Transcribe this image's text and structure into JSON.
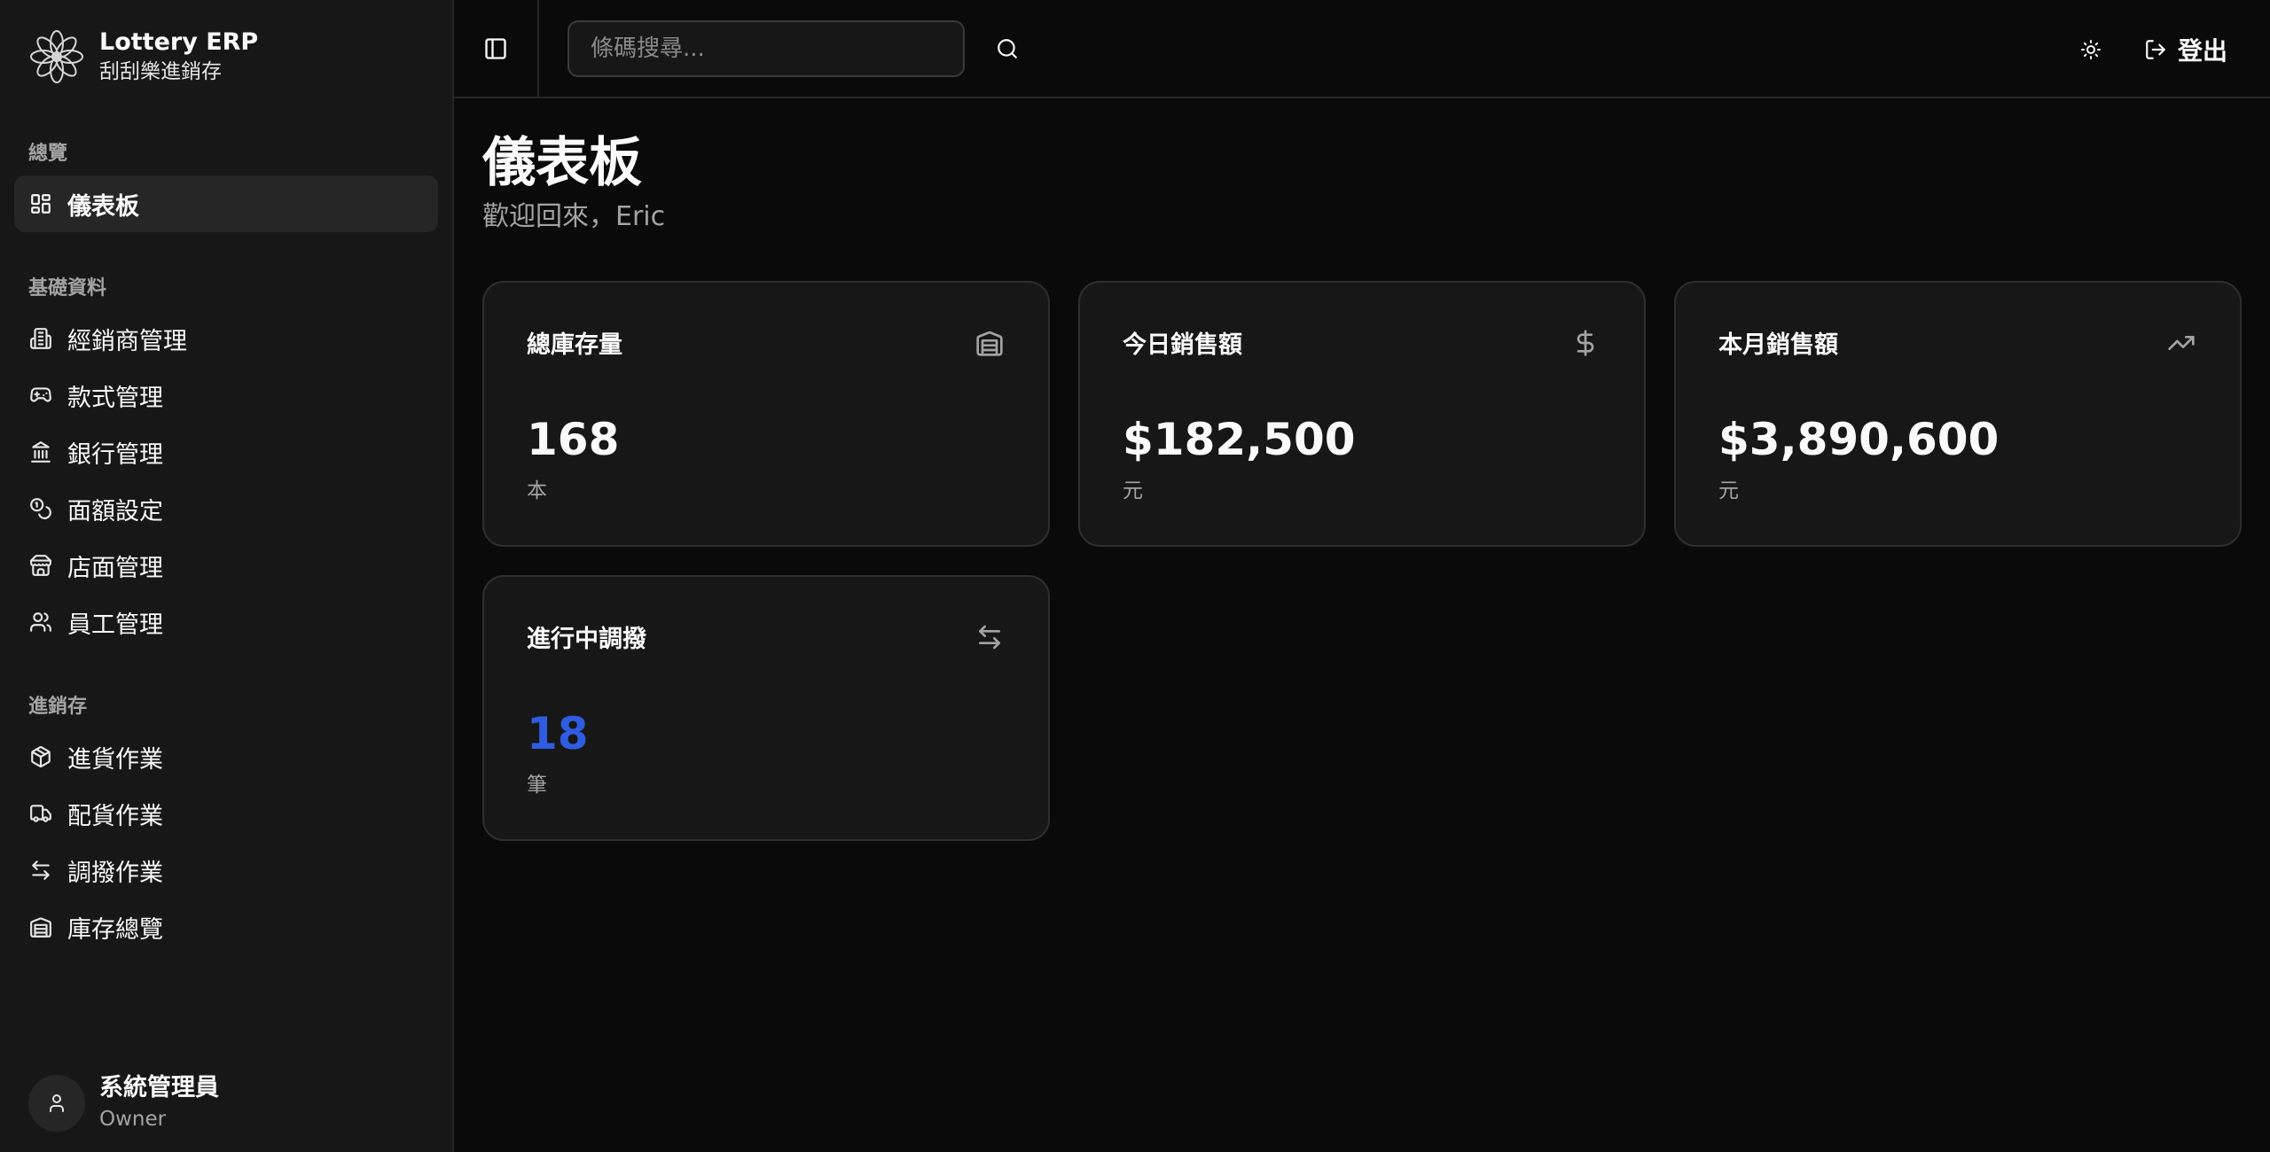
{
  "brand": {
    "name": "Lottery ERP",
    "subtitle": "刮刮樂進銷存",
    "logo_icon": "flower-logo-icon"
  },
  "sidebar": {
    "sections": [
      {
        "label": "總覽",
        "items": [
          {
            "label": "儀表板",
            "icon": "layout-dashboard-icon",
            "active": true
          }
        ]
      },
      {
        "label": "基礎資料",
        "items": [
          {
            "label": "經銷商管理",
            "icon": "building-icon"
          },
          {
            "label": "款式管理",
            "icon": "gamepad-icon"
          },
          {
            "label": "銀行管理",
            "icon": "landmark-icon"
          },
          {
            "label": "面額設定",
            "icon": "coins-icon"
          },
          {
            "label": "店面管理",
            "icon": "store-icon"
          },
          {
            "label": "員工管理",
            "icon": "users-icon"
          }
        ]
      },
      {
        "label": "進銷存",
        "items": [
          {
            "label": "進貨作業",
            "icon": "package-icon"
          },
          {
            "label": "配貨作業",
            "icon": "truck-icon"
          },
          {
            "label": "調撥作業",
            "icon": "arrow-left-right-icon"
          },
          {
            "label": "庫存總覽",
            "icon": "warehouse-icon"
          }
        ]
      }
    ]
  },
  "user": {
    "name": "系統管理員",
    "role": "Owner"
  },
  "topbar": {
    "search_placeholder": "條碼搜尋...",
    "logout_label": "登出"
  },
  "page": {
    "title": "儀表板",
    "subtitle": "歡迎回來，Eric"
  },
  "cards": [
    {
      "label": "總庫存量",
      "value": "168",
      "unit": "本",
      "icon": "warehouse-icon"
    },
    {
      "label": "今日銷售額",
      "value": "$182,500",
      "unit": "元",
      "icon": "dollar-sign-icon"
    },
    {
      "label": "本月銷售額",
      "value": "$3,890,600",
      "unit": "元",
      "icon": "trending-up-icon"
    },
    {
      "label": "進行中調撥",
      "value": "18",
      "unit": "筆",
      "icon": "arrow-left-right-icon",
      "accent": "#2f5ce0"
    }
  ]
}
